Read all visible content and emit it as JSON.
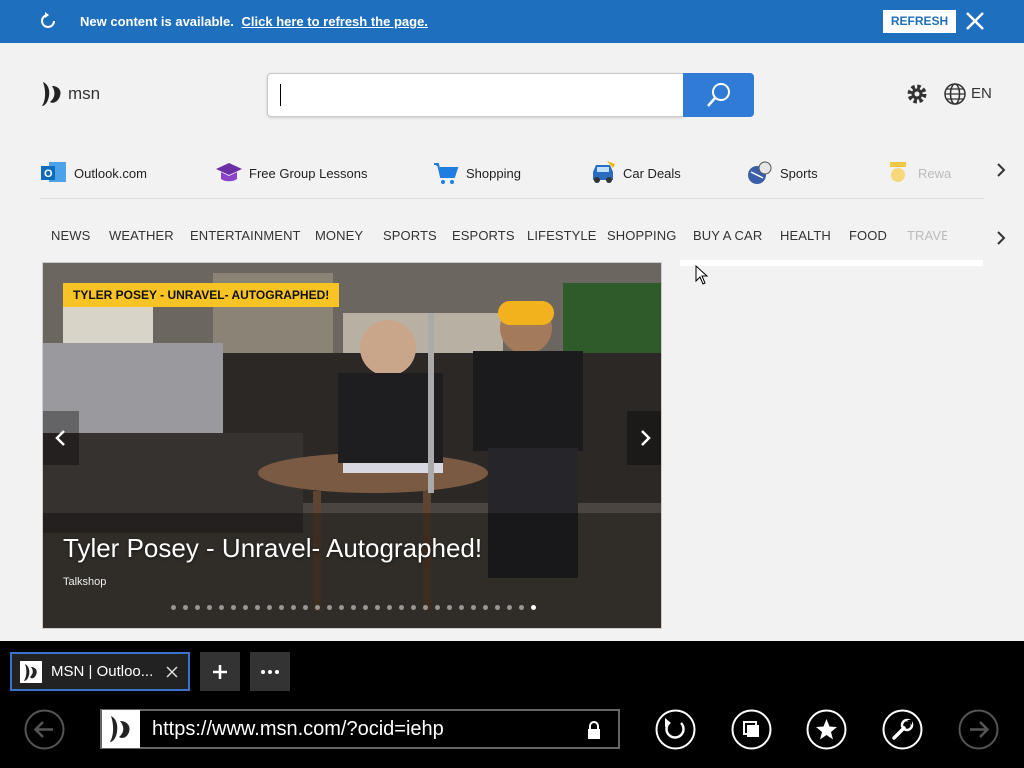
{
  "banner": {
    "message": "New content is available.",
    "link": "Click here to refresh the page.",
    "button": "REFRESH"
  },
  "header": {
    "logo": "msn",
    "search_value": "",
    "lang": "EN"
  },
  "quicklinks": [
    {
      "label": "Outlook.com",
      "icon": "outlook-icon"
    },
    {
      "label": "Free Group Lessons",
      "icon": "graduation-cap-icon"
    },
    {
      "label": "Shopping",
      "icon": "shopping-cart-icon"
    },
    {
      "label": "Car Deals",
      "icon": "car-icon"
    },
    {
      "label": "Sports",
      "icon": "sports-ball-icon"
    },
    {
      "label": "Rewa",
      "icon": "rewards-trophy-icon"
    }
  ],
  "nav": [
    "NEWS",
    "WEATHER",
    "ENTERTAINMENT",
    "MONEY",
    "SPORTS",
    "ESPORTS",
    "LIFESTYLE",
    "SHOPPING",
    "BUY A CAR",
    "HEALTH",
    "FOOD",
    "TRAVE"
  ],
  "hero": {
    "tag": "TYLER POSEY - UNRAVEL- AUTOGRAPHED!",
    "title": "Tyler Posey - Unravel- Autographed!",
    "source": "Talkshop",
    "dots_total": 31,
    "active_dot": 31
  },
  "browser": {
    "tab_title": "MSN | Outloo...",
    "url": "https://www.msn.com/?ocid=iehp"
  },
  "colors": {
    "banner": "#1f6fbf",
    "search_button": "#2f7bd6",
    "tag": "#f7c325"
  }
}
